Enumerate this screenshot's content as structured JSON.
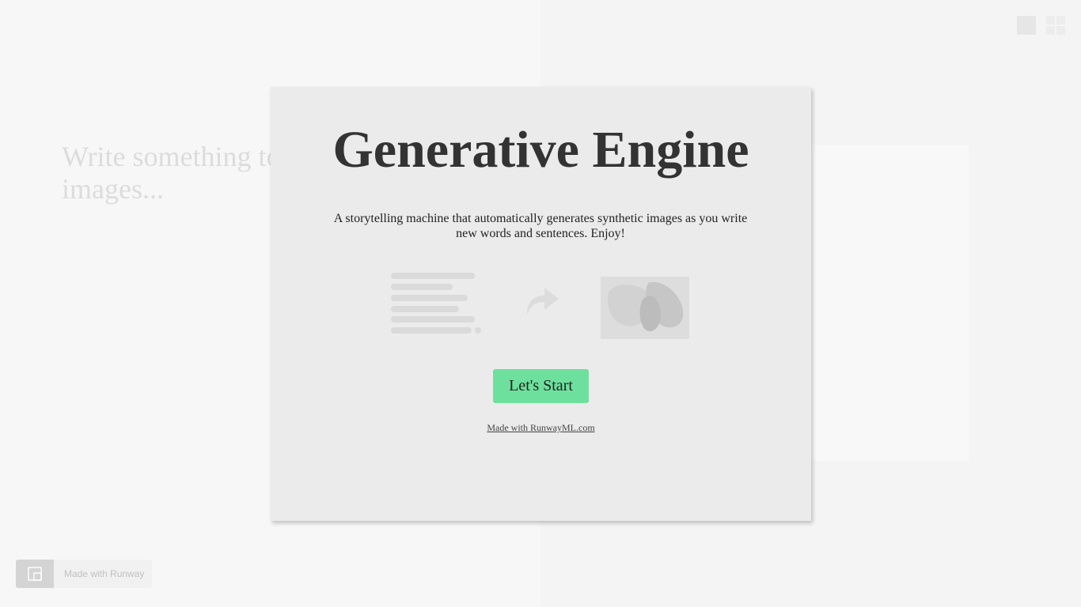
{
  "editor": {
    "placeholder_line1": "Write something to",
    "placeholder_line2": "images..."
  },
  "modal": {
    "title": "Generative Engine",
    "description_line1": "A storytelling machine that automatically generates synthetic images as you write",
    "description_line2": "new words and sentences. Enjoy!",
    "start_button": "Let's Start",
    "footer_link": "Made with RunwayML.com"
  },
  "badge": {
    "label": "Made with Runway",
    "icon": "runway-logo-icon"
  },
  "view_toggle": {
    "single_icon": "single-view-icon",
    "grid_icon": "grid-view-icon"
  },
  "illustration": {
    "left_icon": "text-lines-icon",
    "middle_icon": "arrow-right-icon",
    "right_icon": "generated-image-icon"
  },
  "colors": {
    "accent": "#6ee09d",
    "title": "#333333",
    "modal_bg": "#ebebeb",
    "page_bg": "#f7f7f7"
  }
}
